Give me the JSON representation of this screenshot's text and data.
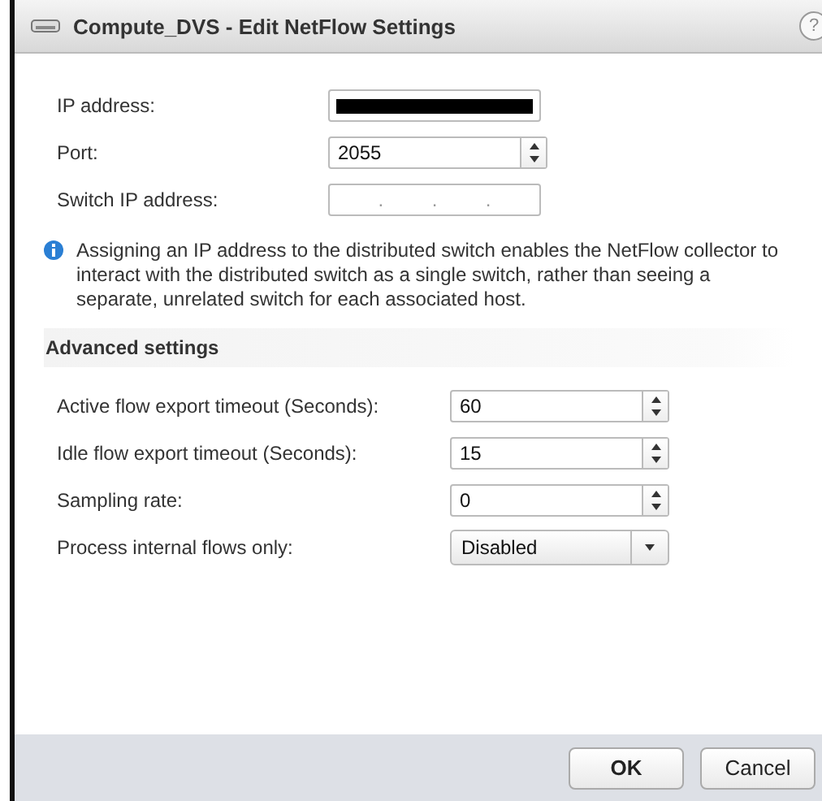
{
  "window": {
    "title": "Compute_DVS - Edit NetFlow Settings",
    "help": "?"
  },
  "fields": [
    {
      "label": "IP address:",
      "kind": "redacted"
    },
    {
      "label": "Port:",
      "kind": "spinner",
      "value": "2055"
    },
    {
      "label": "Switch IP address:",
      "kind": "ip",
      "separators": [
        ".",
        ".",
        "."
      ]
    }
  ],
  "info": "Assigning an IP address to the distributed switch enables the NetFlow collector to interact with the distributed switch as a single switch, rather than seeing a separate, unrelated switch for each associated host.",
  "advanced": {
    "title": "Advanced settings",
    "fields": [
      {
        "label": "Active flow export timeout (Seconds):",
        "kind": "spinner",
        "value": "60"
      },
      {
        "label": "Idle flow export timeout (Seconds):",
        "kind": "spinner",
        "value": "15"
      },
      {
        "label": "Sampling rate:",
        "kind": "spinner",
        "value": "0"
      },
      {
        "label": "Process internal flows only:",
        "kind": "select",
        "value": "Disabled"
      }
    ]
  },
  "buttons": [
    {
      "label": "OK",
      "kind": "primary"
    },
    {
      "label": "Cancel",
      "kind": "normal"
    }
  ]
}
